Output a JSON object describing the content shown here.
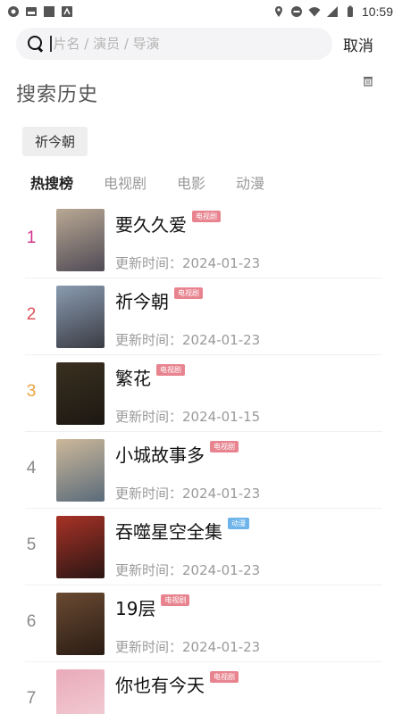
{
  "status_bar": {
    "time": "10:59"
  },
  "search": {
    "placeholder": "片名 / 演员 / 导演",
    "cancel_label": "取消"
  },
  "history": {
    "title": "搜索历史",
    "items": [
      "祈今朝"
    ]
  },
  "tabs": [
    {
      "label": "热搜榜",
      "active": true
    },
    {
      "label": "电视剧",
      "active": false
    },
    {
      "label": "电影",
      "active": false
    },
    {
      "label": "动漫",
      "active": false
    }
  ],
  "update_prefix": "更新时间：",
  "ranking": [
    {
      "rank": "1",
      "title": "要久久爱",
      "badge": "电视剧",
      "date": "2024-01-23",
      "rank_color": "#d2338a",
      "badge_color": "#e8848f",
      "poster_colors": [
        "#b9a893",
        "#4f4a55"
      ]
    },
    {
      "rank": "2",
      "title": "祈今朝",
      "badge": "电视剧",
      "date": "2024-01-23",
      "rank_color": "#e0525a",
      "badge_color": "#e8848f",
      "poster_colors": [
        "#8a9bb0",
        "#3a3c44"
      ]
    },
    {
      "rank": "3",
      "title": "繁花",
      "badge": "电视剧",
      "date": "2024-01-15",
      "rank_color": "#e8a33c",
      "badge_color": "#e8848f",
      "poster_colors": [
        "#3a3020",
        "#1c1812"
      ]
    },
    {
      "rank": "4",
      "title": "小城故事多",
      "badge": "电视剧",
      "date": "2024-01-23",
      "rank_color": "#8a8a8a",
      "badge_color": "#e8848f",
      "poster_colors": [
        "#cdb89a",
        "#5a6b7a"
      ]
    },
    {
      "rank": "5",
      "title": "吞噬星空全集",
      "badge": "动漫",
      "date": "2024-01-23",
      "rank_color": "#8a8a8a",
      "badge_color": "#6db4ea",
      "poster_colors": [
        "#a83226",
        "#2a1614"
      ]
    },
    {
      "rank": "6",
      "title": "19层",
      "badge": "电视剧",
      "date": "2024-01-23",
      "rank_color": "#8a8a8a",
      "badge_color": "#e8848f",
      "poster_colors": [
        "#6a4a32",
        "#2a1c14"
      ]
    },
    {
      "rank": "7",
      "title": "你也有今天",
      "badge": "电视剧",
      "date": "",
      "rank_color": "#8a8a8a",
      "badge_color": "#e8848f",
      "poster_colors": [
        "#e9aab8",
        "#f3d2da"
      ]
    }
  ]
}
